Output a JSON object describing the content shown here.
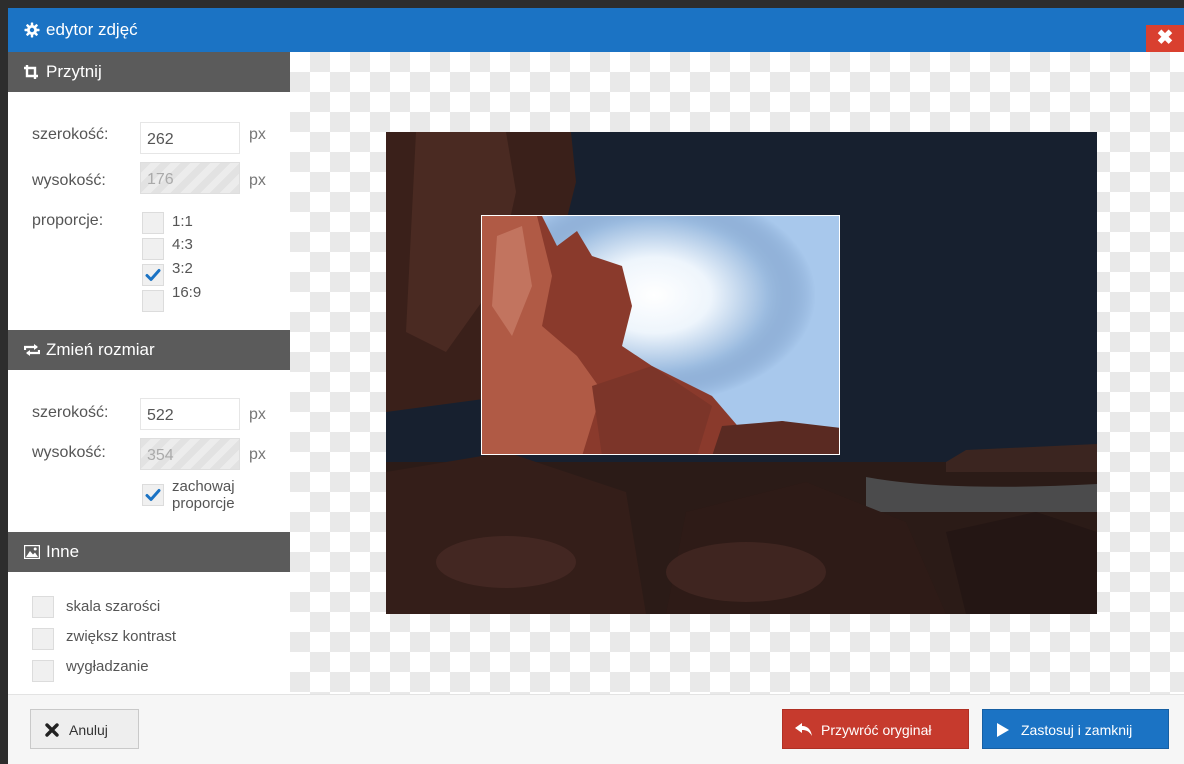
{
  "window": {
    "title": "edytor zdjęć",
    "close_label": "✖"
  },
  "crop": {
    "header": "Przytnij",
    "width_label": "szerokość:",
    "width_value": "262",
    "height_label": "wysokość:",
    "height_value": "176",
    "unit": "px",
    "ratio_label": "proporcje:",
    "ratios": [
      {
        "label": "1:1",
        "checked": false
      },
      {
        "label": "4:3",
        "checked": false
      },
      {
        "label": "3:2",
        "checked": true
      },
      {
        "label": "16:9",
        "checked": false
      }
    ]
  },
  "resize": {
    "header": "Zmień rozmiar",
    "width_label": "szerokość:",
    "width_value": "522",
    "height_label": "wysokość:",
    "height_value": "354",
    "unit": "px",
    "keep_line1": "zachowaj",
    "keep_line2": "proporcje",
    "keep_checked": true
  },
  "other": {
    "header": "Inne",
    "options": [
      {
        "label": "skala szarości",
        "checked": false
      },
      {
        "label": "zwiększ kontrast",
        "checked": false
      },
      {
        "label": "wygładzanie",
        "checked": false
      }
    ]
  },
  "footer": {
    "cancel": "Anuluj",
    "restore": "Przywróć oryginał",
    "apply": "Zastosuj i zamknij"
  },
  "colors": {
    "title_bar": "#1b73c4",
    "close": "#d9402f",
    "section_header": "#5b5b5b",
    "restore_button": "#c63a2d",
    "apply_button": "#1b73c4",
    "check": "#1b73c4"
  },
  "icons": {
    "title": "gear-icon",
    "crop": "crop-icon",
    "resize": "resize-icon",
    "other": "image-icon",
    "cancel": "x-icon",
    "restore": "undo-icon",
    "apply": "play-icon"
  }
}
